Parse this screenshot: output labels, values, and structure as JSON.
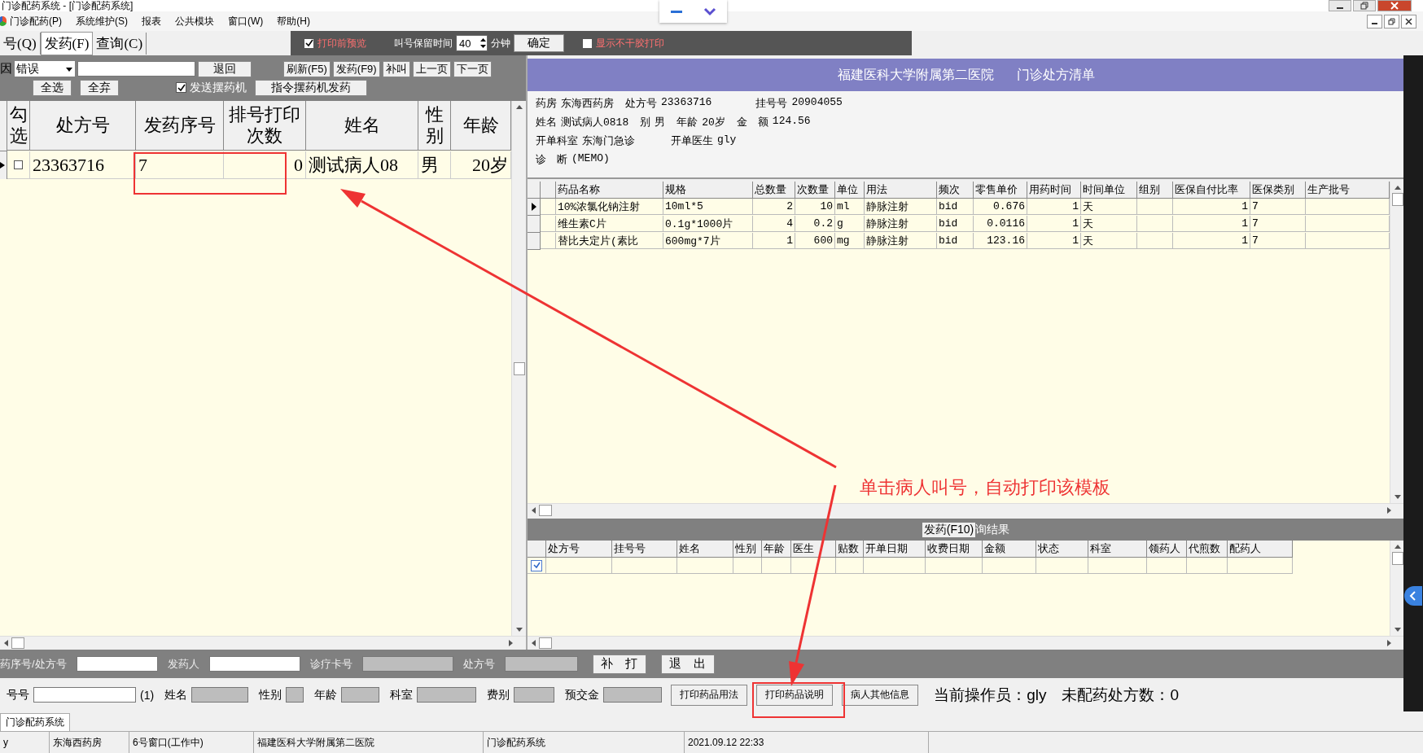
{
  "window": {
    "title": "门诊配药系统 - [门诊配药系统]"
  },
  "menu": [
    "门诊配药(P)",
    "系统维护(S)",
    "报表",
    "公共模块",
    "窗口(W)",
    "帮助(H)"
  ],
  "tabs": [
    {
      "label": "号(Q)",
      "selected": false
    },
    {
      "label": "发药(F)",
      "selected": true
    },
    {
      "label": "查询(C)",
      "selected": false
    }
  ],
  "options": {
    "preview": {
      "label": "打印前预览",
      "checked": true
    },
    "hold_label": "叫号保留时间",
    "hold_value": "40",
    "hold_unit": "分钟",
    "confirm": "确定",
    "sticker": {
      "label": "显示不干胶打印",
      "checked": false
    }
  },
  "left_toolbar": {
    "reason_label": "因",
    "reason_value": "错误",
    "return": "退回",
    "buttons": [
      "刷新(F5)",
      "发药(F9)",
      "补叫",
      "上一页",
      "下一页"
    ],
    "select_all": "全选",
    "deselect_all": "全弃",
    "send": {
      "label": "发送摆药机",
      "checked": true
    },
    "command": "指令摆药机发药"
  },
  "queue_table": {
    "columns": [
      "勾选",
      "处方号",
      "发药序号",
      "排号打印次数",
      "姓名",
      "性别",
      "年龄"
    ],
    "rows": [
      {
        "selected": true,
        "checked": false,
        "cells": [
          "",
          "23363716",
          "7",
          "0",
          "测试病人08",
          "男",
          "20岁"
        ]
      }
    ]
  },
  "prescription": {
    "hospital": "福建医科大学附属第二医院",
    "title": "门诊处方清单",
    "info_lines": [
      [
        {
          "label": "药房",
          "value": "东海西药房"
        },
        {
          "label": "处方号",
          "value": "23363716"
        },
        {
          "label": "挂号号",
          "value": "20904055"
        }
      ],
      [
        {
          "label": "姓名",
          "value": "测试病人0818"
        },
        {
          "label": "别",
          "value": "男"
        },
        {
          "label": "年龄",
          "value": "20岁"
        },
        {
          "label": "金　额",
          "value": "124.56"
        }
      ],
      [
        {
          "label": "开单科室",
          "value": "东海门急诊"
        },
        {
          "label": "开单医生",
          "value": "gly"
        }
      ],
      [
        {
          "label": "诊　断",
          "value": "(MEMO)"
        }
      ]
    ]
  },
  "drug_table": {
    "columns": [
      "药品名称",
      "规格",
      "总数量",
      "次数量",
      "单位",
      "用法",
      "频次",
      "零售单价",
      "用药时间",
      "时间单位",
      "组别",
      "医保自付比率",
      "医保类别",
      "生产批号"
    ],
    "rows": [
      {
        "selected": true,
        "cells": [
          "10%浓氯化钠注射",
          "10ml*5",
          "2",
          "10",
          "ml",
          "静脉注射",
          "bid",
          "0.676",
          "1",
          "天",
          null,
          "1",
          "7",
          null
        ]
      },
      {
        "selected": false,
        "cells": [
          "维生素C片",
          "0.1g*1000片",
          "4",
          "0.2",
          "g",
          "静脉注射",
          "bid",
          "0.0116",
          "1",
          "天",
          null,
          "1",
          "7",
          null
        ]
      },
      {
        "selected": false,
        "cells": [
          "替比夫定片(素比",
          "600mg*7片",
          "1",
          "600",
          "mg",
          "静脉注射",
          "bid",
          "123.16",
          "1",
          "天",
          null,
          "1",
          "7",
          null
        ]
      }
    ]
  },
  "result_tabs": [
    {
      "label": "发药(F10)",
      "selected": true
    },
    {
      "label": "询结果",
      "selected": false
    }
  ],
  "result_table": {
    "columns": [
      "处方号",
      "挂号号",
      "姓名",
      "性别",
      "年龄",
      "医生",
      "贴数",
      "开单日期",
      "收费日期",
      "金额",
      "状态",
      "科室",
      "领药人",
      "代煎数",
      "配药人"
    ],
    "rows": [
      {
        "checked": true
      }
    ]
  },
  "search_bar": {
    "fields": [
      {
        "label": "药序号/处方号",
        "kind": "input"
      },
      {
        "label": "发药人",
        "kind": "input"
      },
      {
        "label": "诊疗卡号",
        "kind": "readonly"
      },
      {
        "label": "处方号",
        "kind": "readonly"
      }
    ],
    "buttons": [
      "补　打",
      "退　出"
    ]
  },
  "patient_bar": {
    "fields": [
      {
        "label": "号号",
        "kind": "input"
      },
      {
        "label": "(1)",
        "kind": "note"
      },
      {
        "label": "姓名",
        "kind": "readonly"
      },
      {
        "label": "性别",
        "kind": "readonly"
      },
      {
        "label": "年龄",
        "kind": "readonly"
      },
      {
        "label": "科室",
        "kind": "readonly"
      },
      {
        "label": "费别",
        "kind": "readonly"
      },
      {
        "label": "预交金",
        "kind": "readonly"
      }
    ],
    "buttons": [
      "打印药品用法",
      "打印药品说明",
      "病人其他信息"
    ],
    "operator": "当前操作员：gly",
    "pending": "未配药处方数：0"
  },
  "mdi_tabs": [
    "门诊配药系统"
  ],
  "status_bar": [
    "y",
    "东海西药房",
    "6号窗口(工作中)",
    "福建医科大学附属第二医院",
    "门诊配药系统",
    "2021.09.12 22:33"
  ],
  "annotation": "单击病人叫号，自动打印该模板"
}
